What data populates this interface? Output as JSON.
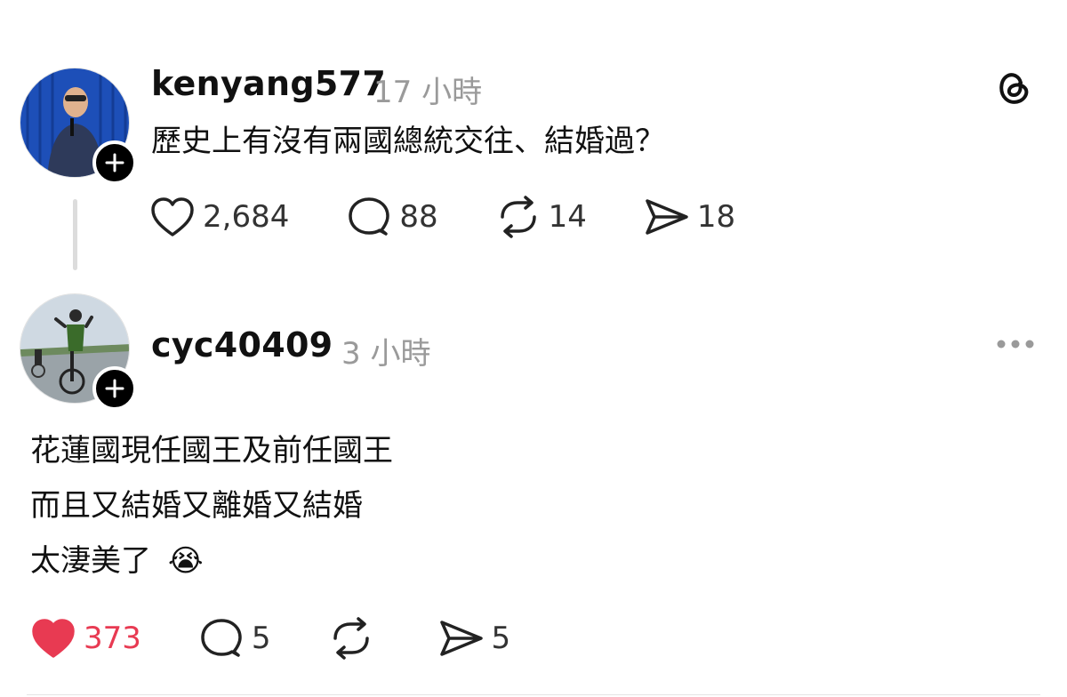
{
  "post": {
    "username": "kenyang577",
    "time": "17 小時",
    "text": "歷史上有沒有兩國總統交往、結婚過？",
    "likes": "2,684",
    "comments": "88",
    "reposts": "14",
    "shares": "18",
    "liked": false
  },
  "reply": {
    "username": "cyc40409",
    "time": "3 小時",
    "lines": [
      "花蓮國現任國王及前任國王",
      "而且又結婚又離婚又結婚",
      "太淒美了"
    ],
    "emoji": "😭",
    "likes": "373",
    "comments": "5",
    "reposts": "",
    "shares": "5",
    "liked": true
  },
  "colors": {
    "liked_red": "#e83a52",
    "muted_gray": "#9a9a9a",
    "text_dark": "#111111"
  },
  "icons": {
    "app_logo": "threads-logo-icon",
    "more": "more-options-icon",
    "follow": "plus-icon",
    "like": "heart-icon",
    "comment": "comment-bubble-icon",
    "repost": "repost-icon",
    "share": "send-icon"
  }
}
